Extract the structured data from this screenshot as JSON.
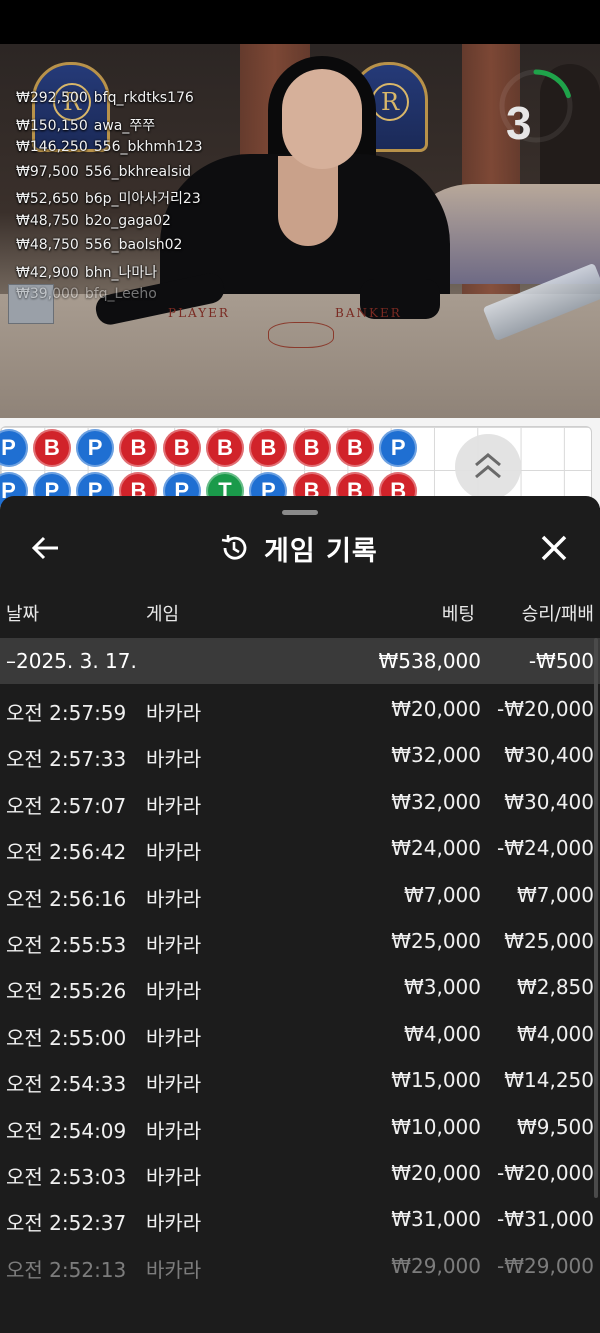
{
  "live_feed": [
    {
      "amount": "₩292,500",
      "user": "bfq_rkdtks176"
    },
    {
      "amount": "₩150,150",
      "user": "awa_쭈쭈"
    },
    {
      "amount": "₩146,250",
      "user": "556_bkhmh123"
    },
    {
      "amount": "₩97,500",
      "user": "556_bkhrealsid"
    },
    {
      "amount": "₩52,650",
      "user": "b6p_미아사거리23"
    },
    {
      "amount": "₩48,750",
      "user": "b2o_gaga02"
    },
    {
      "amount": "₩48,750",
      "user": "556_baolsh02"
    },
    {
      "amount": "₩42,900",
      "user": "bhn_나마나"
    },
    {
      "amount": "₩39,000",
      "user": "bfq_Leeho"
    }
  ],
  "timer": {
    "value": "3",
    "progress": 0.2,
    "color": "#1fa34a"
  },
  "table": {
    "player_label": "PLAYER",
    "banker_label": "BANKER",
    "emblem_letter": "R"
  },
  "bead_road": {
    "row1": [
      "P",
      "B",
      "P",
      "B",
      "B",
      "B",
      "B",
      "B",
      "B",
      "P"
    ],
    "row2": [
      "P",
      "P",
      "P",
      "B",
      "P",
      "T",
      "P",
      "B",
      "B",
      "B"
    ],
    "colors": {
      "B": "#d1232a",
      "P": "#1f6fd2",
      "T": "#1a9a4a"
    }
  },
  "sheet": {
    "title": "게임 기록",
    "columns": {
      "date": "날짜",
      "game": "게임",
      "bet": "베팅",
      "result": "승리/패배"
    },
    "summary": {
      "date": "–2025. 3. 17.",
      "bet": "₩538,000",
      "result": "-₩500"
    },
    "rows": [
      {
        "time": "오전 2:57:59",
        "game": "바카라",
        "bet": "₩20,000",
        "result": "-₩20,000"
      },
      {
        "time": "오전 2:57:33",
        "game": "바카라",
        "bet": "₩32,000",
        "result": "₩30,400"
      },
      {
        "time": "오전 2:57:07",
        "game": "바카라",
        "bet": "₩32,000",
        "result": "₩30,400"
      },
      {
        "time": "오전 2:56:42",
        "game": "바카라",
        "bet": "₩24,000",
        "result": "-₩24,000"
      },
      {
        "time": "오전 2:56:16",
        "game": "바카라",
        "bet": "₩7,000",
        "result": "₩7,000"
      },
      {
        "time": "오전 2:55:53",
        "game": "바카라",
        "bet": "₩25,000",
        "result": "₩25,000"
      },
      {
        "time": "오전 2:55:26",
        "game": "바카라",
        "bet": "₩3,000",
        "result": "₩2,850"
      },
      {
        "time": "오전 2:55:00",
        "game": "바카라",
        "bet": "₩4,000",
        "result": "₩4,000"
      },
      {
        "time": "오전 2:54:33",
        "game": "바카라",
        "bet": "₩15,000",
        "result": "₩14,250"
      },
      {
        "time": "오전 2:54:09",
        "game": "바카라",
        "bet": "₩10,000",
        "result": "₩9,500"
      },
      {
        "time": "오전 2:53:03",
        "game": "바카라",
        "bet": "₩20,000",
        "result": "-₩20,000"
      },
      {
        "time": "오전 2:52:37",
        "game": "바카라",
        "bet": "₩31,000",
        "result": "-₩31,000"
      },
      {
        "time": "오전 2:52:13",
        "game": "바카라",
        "bet": "₩29,000",
        "result": "-₩29,000"
      }
    ]
  }
}
